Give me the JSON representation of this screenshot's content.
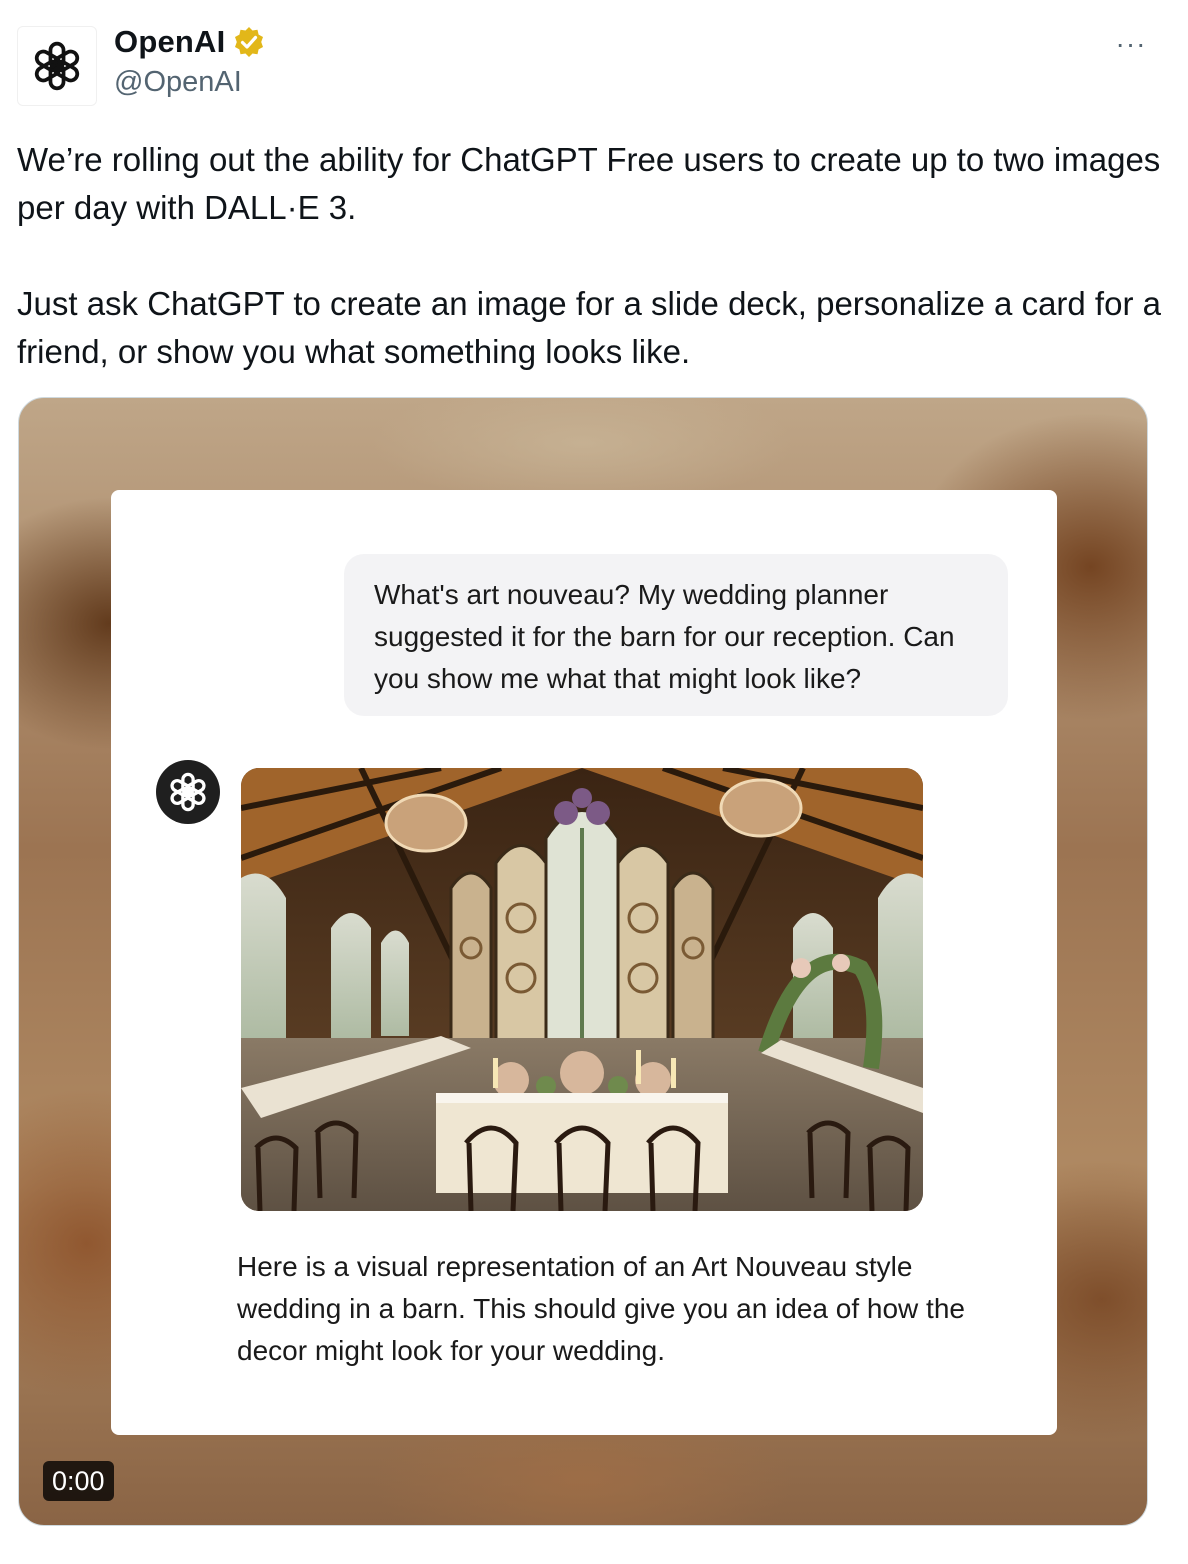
{
  "author": {
    "display_name": "OpenAI",
    "handle": "@OpenAI",
    "verified_badge_color": "#e2b719",
    "avatar_icon": "openai-logo-icon"
  },
  "menu": {
    "more_label": "···"
  },
  "tweet": {
    "paragraphs": [
      "We’re rolling out the ability for ChatGPT Free users to create up to two images per day with DALL·E 3.",
      "Just ask ChatGPT to create an image for a slide deck, personalize a card for a friend, or show you what something looks like."
    ]
  },
  "media": {
    "type": "video",
    "timestamp": "0:00",
    "chat": {
      "user_message": "What's art nouveau? My wedding planner suggested it for the barn for our reception. Can you show me what that might look like?",
      "assistant_icon": "chatgpt-logo-icon",
      "assistant_message": "Here is a visual representation of an Art Nouveau style wedding in a barn. This should give you an idea of how the decor might look for your wedding."
    }
  }
}
